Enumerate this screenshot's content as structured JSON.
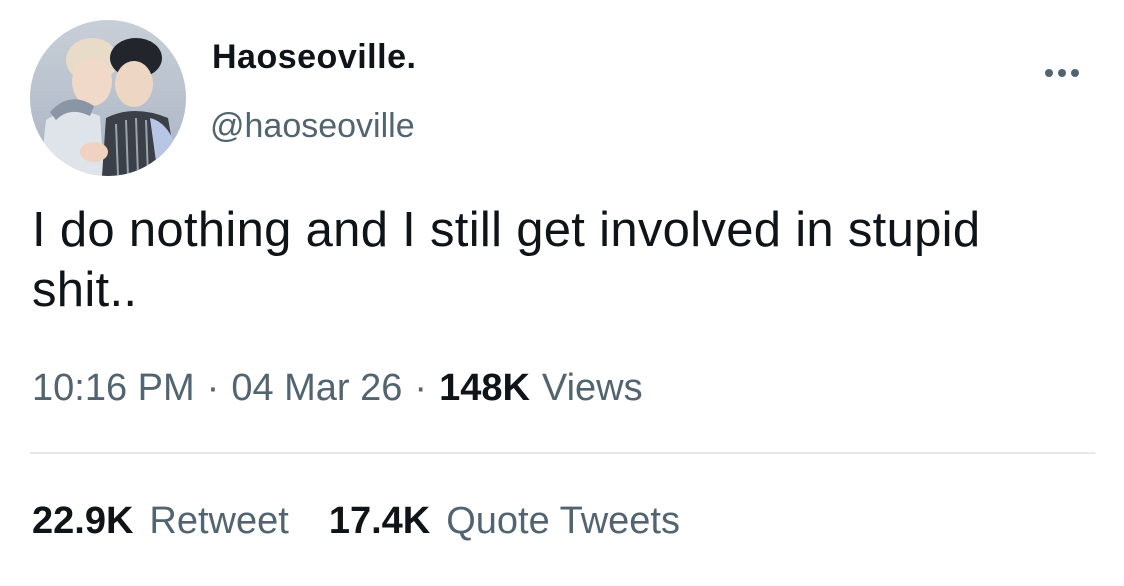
{
  "author": {
    "display_name": "Haoseoville.",
    "handle": "@haoseoville",
    "avatar_icon": "avatar-photo"
  },
  "more_icon": "more-options-icon",
  "tweet": {
    "text": "I do nothing and I still get involved in stupid shit.."
  },
  "meta": {
    "time": "10:16 PM",
    "separator": "·",
    "date": "04 Mar 26",
    "views_count": "148K",
    "views_label": "Views"
  },
  "stats": {
    "retweets_count": "22.9K",
    "retweets_label": "Retweet",
    "quotes_count": "17.4K",
    "quotes_label": "Quote Tweets"
  },
  "colors": {
    "text_primary": "#0f1419",
    "text_secondary": "#536471",
    "divider": "#e6e8ea",
    "background": "#ffffff"
  }
}
